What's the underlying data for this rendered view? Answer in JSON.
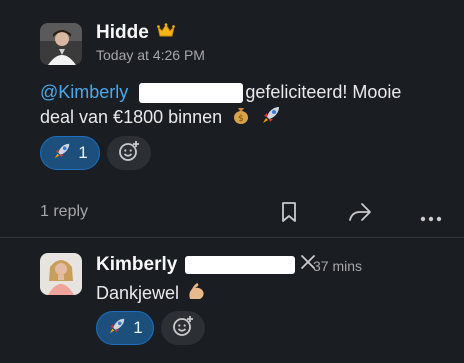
{
  "message": {
    "author": "Hidde",
    "author_badge_icon": "crown-icon",
    "timestamp": "Today at 4:26 PM",
    "mention": "@Kimberly",
    "text_line1": "gefeliciteerd! Mooie",
    "text_line2": "deal van €1800 binnen",
    "emoji_1": "money-bag-icon",
    "emoji_2": "rocket-icon",
    "reaction": {
      "emoji": "rocket-icon",
      "count": "1"
    }
  },
  "thread_actions": {
    "reply_count": "1 reply",
    "bookmark_icon": "bookmark-icon",
    "share_icon": "share-icon",
    "more_icon": "more-icon"
  },
  "reply": {
    "author": "Kimberly",
    "timestamp": "37 mins",
    "text": "Dankjewel",
    "emoji": "flexed-biceps-icon",
    "reaction": {
      "emoji": "rocket-icon",
      "count": "1"
    }
  }
}
